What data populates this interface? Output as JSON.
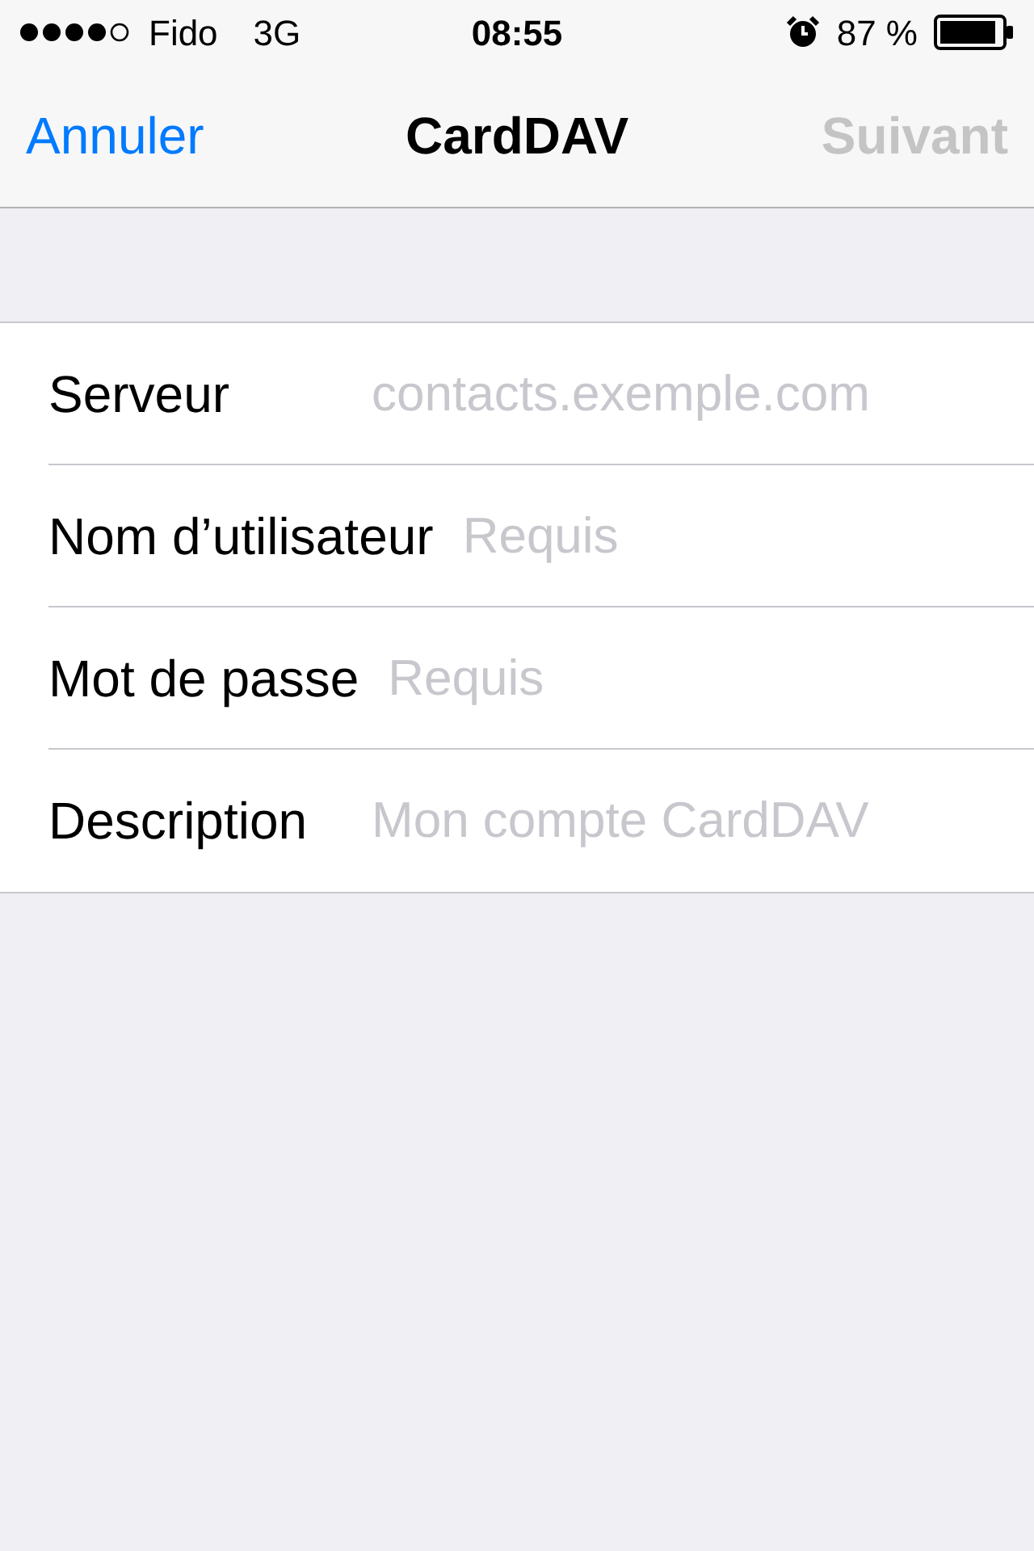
{
  "status_bar": {
    "carrier": "Fido",
    "network": "3G",
    "time": "08:55",
    "battery": "87 %"
  },
  "nav": {
    "left": {
      "label": "Annuler",
      "disabled": false
    },
    "title": "CardDAV",
    "right": {
      "label": "Suivant",
      "disabled": true
    }
  },
  "fields": [
    {
      "label": "Serveur",
      "placeholder": "contacts.exemple.com"
    },
    {
      "label": "Nom d’utilisateur",
      "placeholder": "Requis"
    },
    {
      "label": "Mot de passe",
      "placeholder": "Requis"
    },
    {
      "label": "Description",
      "placeholder": "Mon compte CardDAV"
    }
  ]
}
